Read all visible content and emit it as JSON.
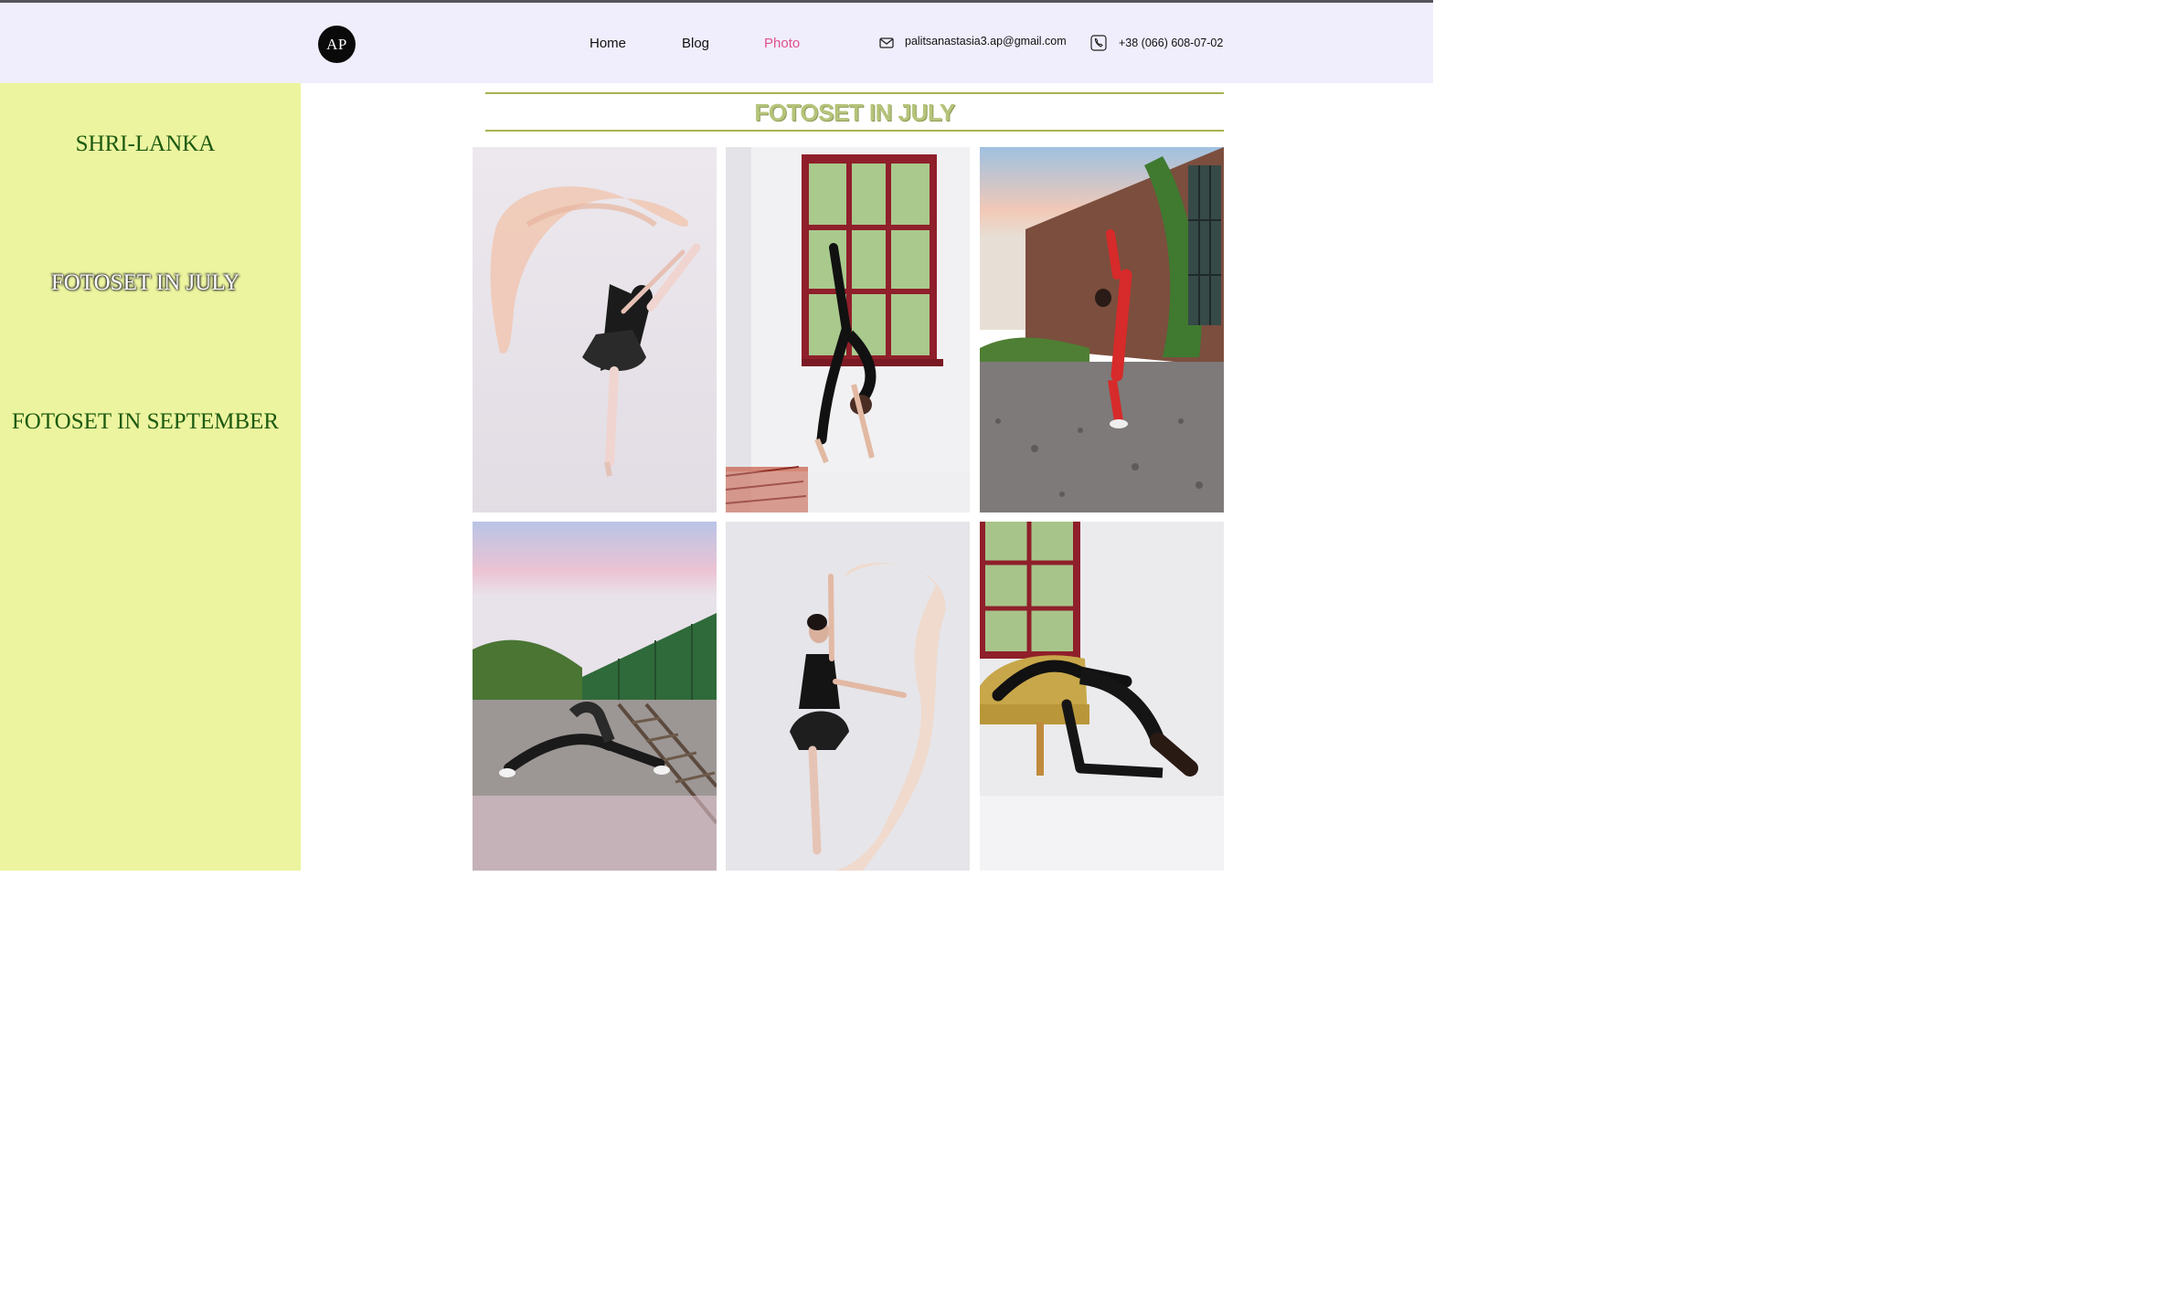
{
  "header": {
    "logo": "AP",
    "nav": [
      {
        "label": "Home",
        "active": false
      },
      {
        "label": "Blog",
        "active": false
      },
      {
        "label": "Photo",
        "active": true
      }
    ],
    "email": "palitsanastasia3.ap@gmail.com",
    "phone": "+38 (066) 608-07-02",
    "icons": {
      "email": "mail-icon",
      "phone": "phone-icon"
    },
    "active_color": "#e0508f"
  },
  "sidebar": {
    "items": [
      {
        "label": "SHRI-LANKA",
        "active": false
      },
      {
        "label": "FOTOSET IN JULY",
        "active": true
      },
      {
        "label": "FOTOSET IN SEPTEMBER",
        "active": false
      }
    ],
    "background": "#ecf49f"
  },
  "main": {
    "title": "FOTOSET IN JULY",
    "photos": [
      {
        "name": "ballerina-pink-scarf"
      },
      {
        "name": "backbend-red-window"
      },
      {
        "name": "leg-hold-red-outfit"
      },
      {
        "name": "railway-stretch"
      },
      {
        "name": "ballerina-scarf-2"
      },
      {
        "name": "backbend-yellow-sofa"
      }
    ]
  }
}
